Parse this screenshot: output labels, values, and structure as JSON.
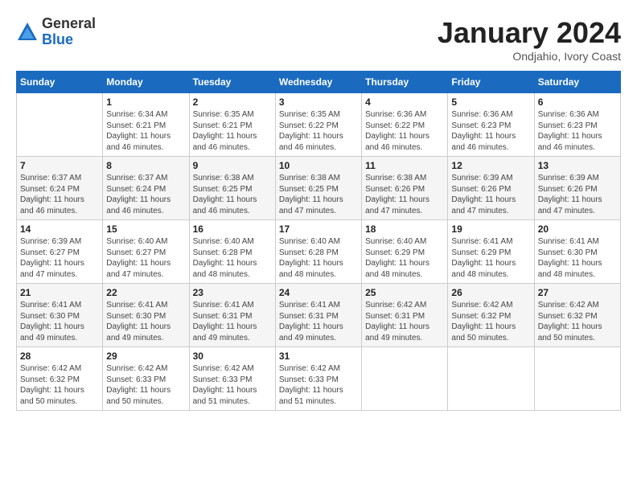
{
  "logo": {
    "general": "General",
    "blue": "Blue"
  },
  "title": "January 2024",
  "location": "Ondjahio, Ivory Coast",
  "days_of_week": [
    "Sunday",
    "Monday",
    "Tuesday",
    "Wednesday",
    "Thursday",
    "Friday",
    "Saturday"
  ],
  "weeks": [
    [
      {
        "day": "",
        "sunrise": "",
        "sunset": "",
        "daylight": ""
      },
      {
        "day": "1",
        "sunrise": "Sunrise: 6:34 AM",
        "sunset": "Sunset: 6:21 PM",
        "daylight": "Daylight: 11 hours and 46 minutes."
      },
      {
        "day": "2",
        "sunrise": "Sunrise: 6:35 AM",
        "sunset": "Sunset: 6:21 PM",
        "daylight": "Daylight: 11 hours and 46 minutes."
      },
      {
        "day": "3",
        "sunrise": "Sunrise: 6:35 AM",
        "sunset": "Sunset: 6:22 PM",
        "daylight": "Daylight: 11 hours and 46 minutes."
      },
      {
        "day": "4",
        "sunrise": "Sunrise: 6:36 AM",
        "sunset": "Sunset: 6:22 PM",
        "daylight": "Daylight: 11 hours and 46 minutes."
      },
      {
        "day": "5",
        "sunrise": "Sunrise: 6:36 AM",
        "sunset": "Sunset: 6:23 PM",
        "daylight": "Daylight: 11 hours and 46 minutes."
      },
      {
        "day": "6",
        "sunrise": "Sunrise: 6:36 AM",
        "sunset": "Sunset: 6:23 PM",
        "daylight": "Daylight: 11 hours and 46 minutes."
      }
    ],
    [
      {
        "day": "7",
        "sunrise": "Sunrise: 6:37 AM",
        "sunset": "Sunset: 6:24 PM",
        "daylight": "Daylight: 11 hours and 46 minutes."
      },
      {
        "day": "8",
        "sunrise": "Sunrise: 6:37 AM",
        "sunset": "Sunset: 6:24 PM",
        "daylight": "Daylight: 11 hours and 46 minutes."
      },
      {
        "day": "9",
        "sunrise": "Sunrise: 6:38 AM",
        "sunset": "Sunset: 6:25 PM",
        "daylight": "Daylight: 11 hours and 46 minutes."
      },
      {
        "day": "10",
        "sunrise": "Sunrise: 6:38 AM",
        "sunset": "Sunset: 6:25 PM",
        "daylight": "Daylight: 11 hours and 47 minutes."
      },
      {
        "day": "11",
        "sunrise": "Sunrise: 6:38 AM",
        "sunset": "Sunset: 6:26 PM",
        "daylight": "Daylight: 11 hours and 47 minutes."
      },
      {
        "day": "12",
        "sunrise": "Sunrise: 6:39 AM",
        "sunset": "Sunset: 6:26 PM",
        "daylight": "Daylight: 11 hours and 47 minutes."
      },
      {
        "day": "13",
        "sunrise": "Sunrise: 6:39 AM",
        "sunset": "Sunset: 6:26 PM",
        "daylight": "Daylight: 11 hours and 47 minutes."
      }
    ],
    [
      {
        "day": "14",
        "sunrise": "Sunrise: 6:39 AM",
        "sunset": "Sunset: 6:27 PM",
        "daylight": "Daylight: 11 hours and 47 minutes."
      },
      {
        "day": "15",
        "sunrise": "Sunrise: 6:40 AM",
        "sunset": "Sunset: 6:27 PM",
        "daylight": "Daylight: 11 hours and 47 minutes."
      },
      {
        "day": "16",
        "sunrise": "Sunrise: 6:40 AM",
        "sunset": "Sunset: 6:28 PM",
        "daylight": "Daylight: 11 hours and 48 minutes."
      },
      {
        "day": "17",
        "sunrise": "Sunrise: 6:40 AM",
        "sunset": "Sunset: 6:28 PM",
        "daylight": "Daylight: 11 hours and 48 minutes."
      },
      {
        "day": "18",
        "sunrise": "Sunrise: 6:40 AM",
        "sunset": "Sunset: 6:29 PM",
        "daylight": "Daylight: 11 hours and 48 minutes."
      },
      {
        "day": "19",
        "sunrise": "Sunrise: 6:41 AM",
        "sunset": "Sunset: 6:29 PM",
        "daylight": "Daylight: 11 hours and 48 minutes."
      },
      {
        "day": "20",
        "sunrise": "Sunrise: 6:41 AM",
        "sunset": "Sunset: 6:30 PM",
        "daylight": "Daylight: 11 hours and 48 minutes."
      }
    ],
    [
      {
        "day": "21",
        "sunrise": "Sunrise: 6:41 AM",
        "sunset": "Sunset: 6:30 PM",
        "daylight": "Daylight: 11 hours and 49 minutes."
      },
      {
        "day": "22",
        "sunrise": "Sunrise: 6:41 AM",
        "sunset": "Sunset: 6:30 PM",
        "daylight": "Daylight: 11 hours and 49 minutes."
      },
      {
        "day": "23",
        "sunrise": "Sunrise: 6:41 AM",
        "sunset": "Sunset: 6:31 PM",
        "daylight": "Daylight: 11 hours and 49 minutes."
      },
      {
        "day": "24",
        "sunrise": "Sunrise: 6:41 AM",
        "sunset": "Sunset: 6:31 PM",
        "daylight": "Daylight: 11 hours and 49 minutes."
      },
      {
        "day": "25",
        "sunrise": "Sunrise: 6:42 AM",
        "sunset": "Sunset: 6:31 PM",
        "daylight": "Daylight: 11 hours and 49 minutes."
      },
      {
        "day": "26",
        "sunrise": "Sunrise: 6:42 AM",
        "sunset": "Sunset: 6:32 PM",
        "daylight": "Daylight: 11 hours and 50 minutes."
      },
      {
        "day": "27",
        "sunrise": "Sunrise: 6:42 AM",
        "sunset": "Sunset: 6:32 PM",
        "daylight": "Daylight: 11 hours and 50 minutes."
      }
    ],
    [
      {
        "day": "28",
        "sunrise": "Sunrise: 6:42 AM",
        "sunset": "Sunset: 6:32 PM",
        "daylight": "Daylight: 11 hours and 50 minutes."
      },
      {
        "day": "29",
        "sunrise": "Sunrise: 6:42 AM",
        "sunset": "Sunset: 6:33 PM",
        "daylight": "Daylight: 11 hours and 50 minutes."
      },
      {
        "day": "30",
        "sunrise": "Sunrise: 6:42 AM",
        "sunset": "Sunset: 6:33 PM",
        "daylight": "Daylight: 11 hours and 51 minutes."
      },
      {
        "day": "31",
        "sunrise": "Sunrise: 6:42 AM",
        "sunset": "Sunset: 6:33 PM",
        "daylight": "Daylight: 11 hours and 51 minutes."
      },
      {
        "day": "",
        "sunrise": "",
        "sunset": "",
        "daylight": ""
      },
      {
        "day": "",
        "sunrise": "",
        "sunset": "",
        "daylight": ""
      },
      {
        "day": "",
        "sunrise": "",
        "sunset": "",
        "daylight": ""
      }
    ]
  ]
}
